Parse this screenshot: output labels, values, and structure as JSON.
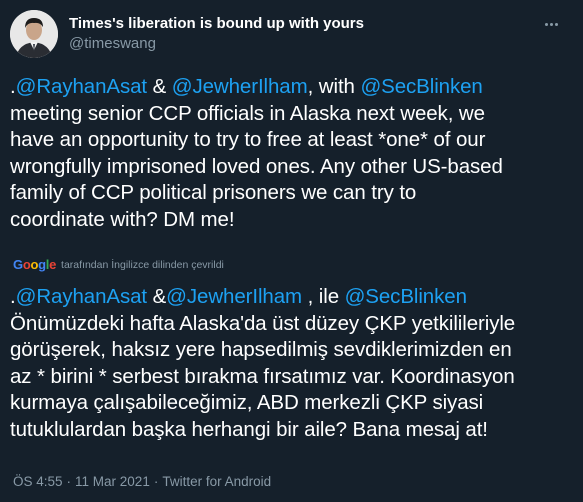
{
  "author": {
    "display_name": "Times's liberation is bound up with yours",
    "handle": "@timeswang",
    "avatar_icon": "profile-photo"
  },
  "tweet": {
    "original": [
      {
        "text": ".",
        "type": "plain"
      },
      {
        "text": "@RayhanAsat",
        "type": "mention"
      },
      {
        "text": " & ",
        "type": "plain"
      },
      {
        "text": "@JewherIlham",
        "type": "mention"
      },
      {
        "text": ", with ",
        "type": "plain"
      },
      {
        "text": "@SecBlinken",
        "type": "mention"
      },
      {
        "text": "\nmeeting senior CCP officials in Alaska next week, we\nhave an opportunity to try to free at least *one* of our\nwrongfully imprisoned loved ones. Any other US-based\nfamily of CCP political prisoners we can try to\ncoordinate with? DM me!",
        "type": "plain"
      }
    ],
    "translation_provider": "Google",
    "translation_note": "tarafından İngilizce dilinden çevrildi",
    "translated": [
      {
        "text": ".",
        "type": "plain"
      },
      {
        "text": "@RayhanAsat",
        "type": "mention"
      },
      {
        "text": " &",
        "type": "plain"
      },
      {
        "text": "@JewherIlham",
        "type": "mention"
      },
      {
        "text": " , ile ",
        "type": "plain"
      },
      {
        "text": "@SecBlinken",
        "type": "mention"
      },
      {
        "text": "\nÖnümüzdeki hafta Alaska'da üst düzey ÇKP yetkilileriyle\ngörüşerek, haksız yere hapsedilmiş sevdiklerimizden en\naz * birini * serbest bırakma fırsatımız var. Koordinasyon\nkurmaya çalışabileceğimiz, ABD merkezli ÇKP siyasi\ntutuklulardan başka herhangi bir aile? Bana mesaj at!",
        "type": "plain"
      }
    ]
  },
  "meta": {
    "time": "ÖS 4:55",
    "separator": "·",
    "date": "11 Mar 2021",
    "source": "Twitter for Android"
  },
  "colors": {
    "background": "#15202b",
    "mention": "#1da1f2",
    "secondary_text": "#8899a6"
  }
}
